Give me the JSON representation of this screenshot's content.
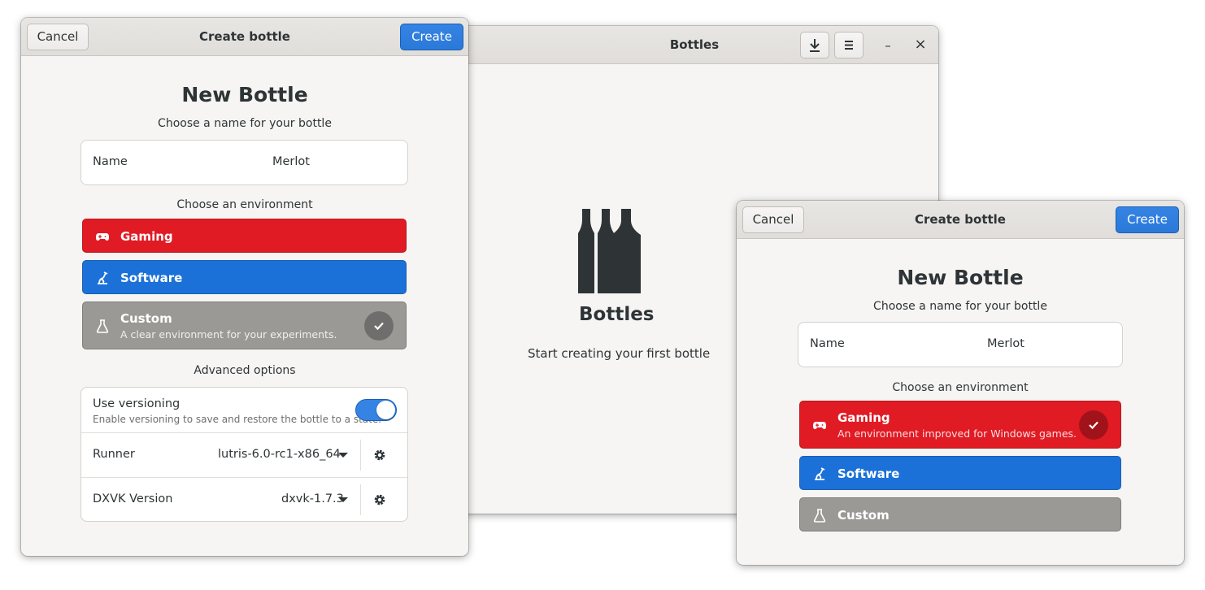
{
  "main_window": {
    "title": "Bottles",
    "empty_title": "Bottles",
    "empty_subtitle": "Start creating your first bottle",
    "minimize_glyph": "–",
    "close_glyph": "×",
    "icons": [
      "download-icon",
      "menu-icon",
      "bottles-logo"
    ]
  },
  "dialog_left": {
    "title": "Create bottle",
    "cancel_label": "Cancel",
    "create_label": "Create",
    "heading": "New Bottle",
    "name_prompt": "Choose a name for your bottle",
    "name_label": "Name",
    "name_value": "Merlot",
    "env_prompt": "Choose an environment",
    "environments": [
      {
        "label": "Gaming",
        "description": "",
        "icon": "gamepad-icon"
      },
      {
        "label": "Software",
        "description": "",
        "icon": "software-icon"
      },
      {
        "label": "Custom",
        "description": "A clear environment for your experiments.",
        "icon": "flask-icon",
        "selected": true
      }
    ],
    "advanced_title": "Advanced options",
    "versioning_label": "Use versioning",
    "versioning_desc": "Enable versioning to save and restore the bottle to a state.",
    "versioning_on": true,
    "runner_label": "Runner",
    "runner_value": "lutris-6.0-rc1-x86_64",
    "dxvk_label": "DXVK Version",
    "dxvk_value": "dxvk-1.7.3"
  },
  "dialog_right": {
    "title": "Create bottle",
    "cancel_label": "Cancel",
    "create_label": "Create",
    "heading": "New Bottle",
    "name_prompt": "Choose a name for your bottle",
    "name_label": "Name",
    "name_value": "Merlot",
    "env_prompt": "Choose an environment",
    "environments": [
      {
        "label": "Gaming",
        "description": "An environment improved for Windows games.",
        "icon": "gamepad-icon",
        "selected": true
      },
      {
        "label": "Software",
        "description": "",
        "icon": "software-icon"
      },
      {
        "label": "Custom",
        "description": "",
        "icon": "flask-icon"
      }
    ]
  },
  "colors": {
    "accent": "#3584e4",
    "gaming": "#e01b24",
    "software": "#1c71d8",
    "custom": "#9a9996"
  }
}
